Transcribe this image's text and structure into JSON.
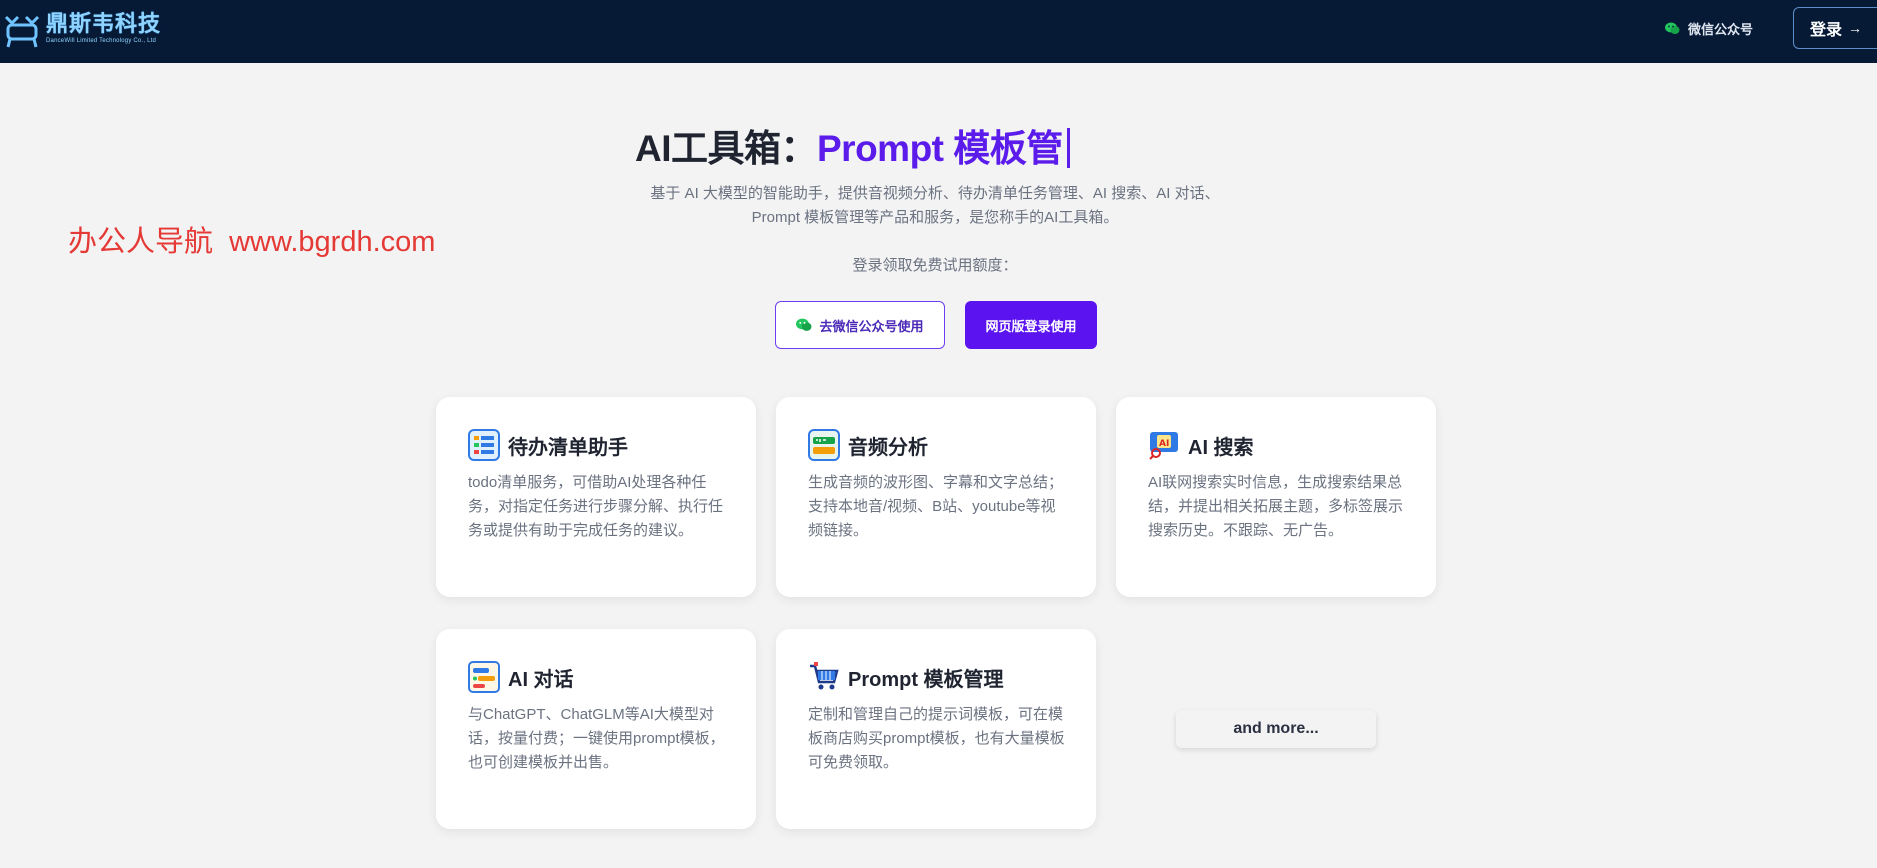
{
  "header": {
    "logo_text": "鼎斯韦科技",
    "logo_subtext": "DanceWill Limited Technology Co., Ltd",
    "wechat_label": "微信公众号",
    "login_label": "登录"
  },
  "hero": {
    "title_prefix": "AI工具箱：",
    "title_accent": "Prompt 模板管",
    "description": "基于 AI 大模型的智能助手，提供音视频分析、待办清单任务管理、AI 搜索、AI 对话、Prompt 模板管理等产品和服务，是您称手的AI工具箱。",
    "subtext": "登录领取免费试用额度：",
    "btn_wechat": "去微信公众号使用",
    "btn_web": "网页版登录使用"
  },
  "watermark": "办公人导航  www.bgrdh.com",
  "cards": [
    {
      "icon": "todo-list-icon",
      "title": "待办清单助手",
      "desc": "todo清单服务，可借助AI处理各种任务，对指定任务进行步骤分解、执行任务或提供有助于完成任务的建议。"
    },
    {
      "icon": "audio-analysis-icon",
      "title": "音频分析",
      "desc": "生成音频的波形图、字幕和文字总结；支持本地音/视频、B站、youtube等视频链接。"
    },
    {
      "icon": "ai-search-icon",
      "title": "AI 搜索",
      "desc": "AI联网搜索实时信息，生成搜索结果总结，并提出相关拓展主题，多标签展示搜索历史。不跟踪、无广告。"
    },
    {
      "icon": "ai-chat-icon",
      "title": "AI 对话",
      "desc": "与ChatGPT、ChatGLM等AI大模型对话，按量付费；一键使用prompt模板，也可创建模板并出售。"
    },
    {
      "icon": "shopping-cart-icon",
      "title": "Prompt 模板管理",
      "desc": "定制和管理自己的提示词模板，可在模板商店购买prompt模板，也有大量模板可免费领取。"
    }
  ],
  "more_label": "and more...",
  "colors": {
    "header_bg": "#061a36",
    "accent": "#5b14f0",
    "page_bg": "#f3f3f4"
  }
}
